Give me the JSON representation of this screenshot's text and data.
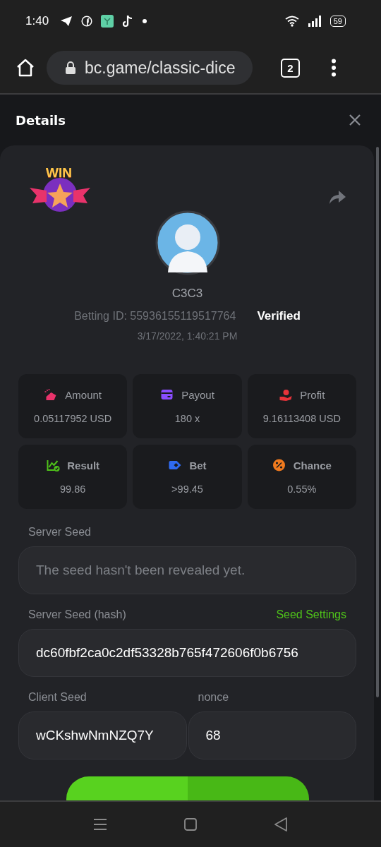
{
  "status_bar": {
    "time": "1:40",
    "battery": "59"
  },
  "browser": {
    "url": "bc.game/classic-dice",
    "tab_count": "2"
  },
  "dialog": {
    "title": "Details"
  },
  "bet": {
    "badge": "WIN",
    "username": "C3C3",
    "betting_id": "Betting ID: 55936155119517764",
    "verified": "Verified",
    "date": "3/17/2022, 1:40:21 PM"
  },
  "stats": [
    {
      "kind": "amount",
      "label": "Amount",
      "value": "0.05117952 USD",
      "bold": false,
      "color": "#e8336b"
    },
    {
      "kind": "payout",
      "label": "Payout",
      "value": "180 x",
      "bold": false,
      "color": "#8a4dff"
    },
    {
      "kind": "profit",
      "label": "Profit",
      "value": "9.16113408 USD",
      "bold": false,
      "color": "#e8333a"
    },
    {
      "kind": "result",
      "label": "Result",
      "value": "99.86",
      "bold": true,
      "color": "#4fc31a"
    },
    {
      "kind": "bet",
      "label": "Bet",
      "value": ">99.45",
      "bold": true,
      "color": "#2f6bf0"
    },
    {
      "kind": "chance",
      "label": "Chance",
      "value": "0.55%",
      "bold": true,
      "color": "#f07a1e"
    }
  ],
  "server_seed": {
    "label": "Server Seed",
    "placeholder": "The seed hasn't been revealed yet."
  },
  "server_seed_hash": {
    "label": "Server Seed (hash)",
    "link": "Seed Settings",
    "value": "dc60fbf2ca0c2df53328b765f472606f0b6756"
  },
  "client_seed": {
    "label": "Client Seed",
    "value": "wCKshwNmNZQ7Y"
  },
  "nonce": {
    "label": "nonce",
    "value": "68"
  }
}
